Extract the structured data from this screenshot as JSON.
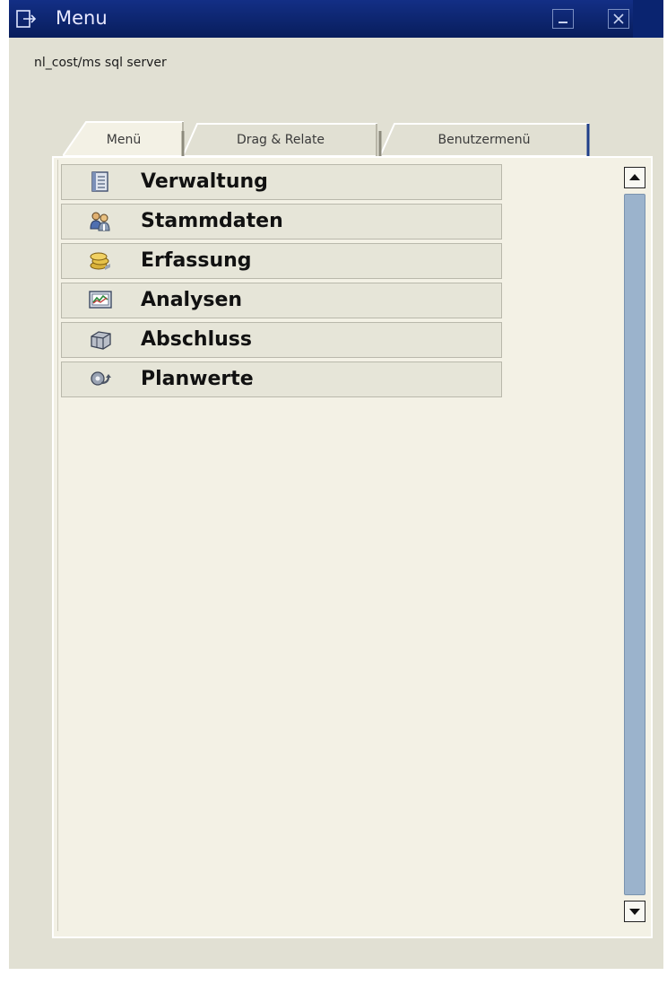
{
  "window": {
    "title": "Menu",
    "titlebar_color": "#0a2470",
    "minimize_icon": "minimize-icon",
    "close_icon": "close-icon"
  },
  "header": {
    "server": "nl_cost/ms sql server"
  },
  "tabs": [
    {
      "label": "Menü",
      "active": true
    },
    {
      "label": "Drag & Relate",
      "active": false
    },
    {
      "label": "Benutzermenü",
      "active": false
    }
  ],
  "tree": {
    "items": [
      {
        "label": "Verwaltung",
        "icon": "folder-list-icon"
      },
      {
        "label": "Stammdaten",
        "icon": "people-icon"
      },
      {
        "label": "Erfassung",
        "icon": "coins-stack-icon"
      },
      {
        "label": "Analysen",
        "icon": "chart-monitor-icon"
      },
      {
        "label": "Abschluss",
        "icon": "box-icon"
      },
      {
        "label": "Planwerte",
        "icon": "gear-arrow-icon"
      }
    ]
  },
  "scrollbar": {
    "up_icon": "scroll-up-icon",
    "down_icon": "scroll-down-icon",
    "thumb_color": "#9bb3cc"
  }
}
